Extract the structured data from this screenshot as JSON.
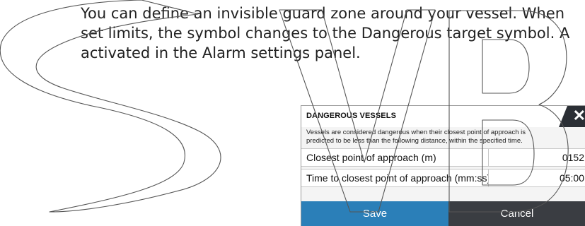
{
  "document": {
    "paragraph_lines": [
      "You can define an invisible guard zone around your vessel. When",
      "set limits, the symbol changes to the Dangerous target symbol. A",
      "activated in the Alarm settings panel."
    ]
  },
  "dialog": {
    "title": "DANGEROUS VESSELS",
    "close_icon": "close-icon",
    "description_lines": [
      "Vessels are considered dangerous when their closest point of approach is",
      "predicted to be less than the following distance, within the specified time."
    ],
    "fields": [
      {
        "label": "Closest point of approach (m)",
        "value": "0152"
      },
      {
        "label": "Time to closest point of approach (mm:ss)",
        "value": "05:00"
      }
    ],
    "save_label": "Save",
    "cancel_label": "Cancel"
  },
  "colors": {
    "save_button": "#2b7fb8",
    "cancel_button": "#3a3d42",
    "close_tab": "#2b2f35",
    "dialog_bg": "#f4f4f4"
  }
}
